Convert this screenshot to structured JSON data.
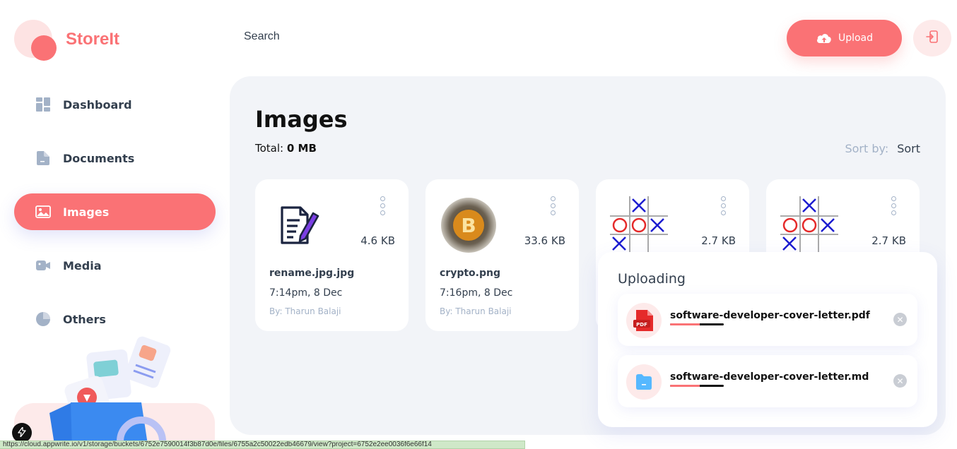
{
  "app": {
    "name": "StoreIt"
  },
  "header": {
    "search_label": "Search",
    "upload_label": "Upload"
  },
  "sidebar": {
    "items": [
      {
        "label": "Dashboard",
        "icon": "dashboard-icon",
        "active": false
      },
      {
        "label": "Documents",
        "icon": "documents-icon",
        "active": false
      },
      {
        "label": "Images",
        "icon": "images-icon",
        "active": true
      },
      {
        "label": "Media",
        "icon": "media-icon",
        "active": false
      },
      {
        "label": "Others",
        "icon": "others-icon",
        "active": false
      }
    ]
  },
  "main": {
    "title": "Images",
    "total_label": "Total:",
    "total_value": "0 MB",
    "sort_label": "Sort by:",
    "sort_value": "Sort",
    "files": [
      {
        "name": "rename.jpg.jpg",
        "size": "4.6 KB",
        "date": "7:14pm, 8 Dec",
        "owner": "By: Tharun Balaji",
        "thumb": "document-edit-icon"
      },
      {
        "name": "crypto.png",
        "size": "33.6 KB",
        "date": "7:16pm, 8 Dec",
        "owner": "By: Tharun Balaji",
        "thumb": "bitcoin-image"
      },
      {
        "name": "",
        "size": "2.7 KB",
        "date": "",
        "owner": "",
        "thumb": "tictactoe-image"
      },
      {
        "name": "",
        "size": "2.7 KB",
        "date": "",
        "owner": "",
        "thumb": "tictactoe-image"
      }
    ]
  },
  "uploading": {
    "title": "Uploading",
    "items": [
      {
        "name": "software-developer-cover-letter.pdf",
        "icon": "pdf-icon",
        "progress": 0.55
      },
      {
        "name": "software-developer-cover-letter.md",
        "icon": "file-icon",
        "progress": 0.55
      }
    ]
  },
  "status_bar": {
    "url": "https://cloud.appwrite.io/v1/storage/buckets/6752e7590014f3b87d0e/files/6755a2c50022edb46679/view?project=6752e2ee0036f6e66f14"
  },
  "colors": {
    "brand": "#FA7275",
    "panel_bg": "#F2F4F8",
    "muted": "#A3B2C7"
  }
}
